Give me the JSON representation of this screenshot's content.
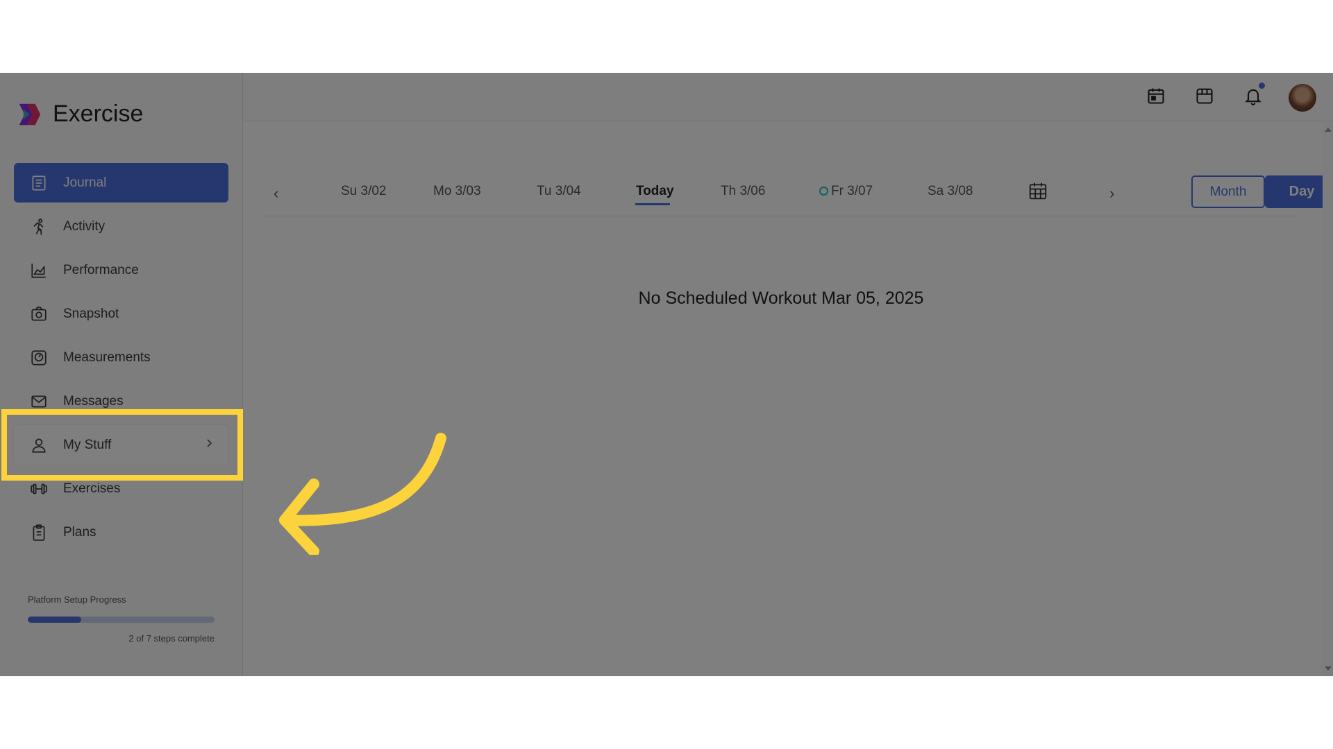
{
  "app": {
    "name": "Exercise"
  },
  "sidebar": {
    "items": [
      {
        "label": "Journal",
        "icon": "journal-icon"
      },
      {
        "label": "Activity",
        "icon": "running-figure-icon"
      },
      {
        "label": "Performance",
        "icon": "area-chart-icon"
      },
      {
        "label": "Snapshot",
        "icon": "camera-icon"
      },
      {
        "label": "Measurements",
        "icon": "scale-icon"
      },
      {
        "label": "Messages",
        "icon": "envelope-icon"
      },
      {
        "label": "My Stuff",
        "icon": "user-icon"
      },
      {
        "label": "Exercises",
        "icon": "dumbbell-icon"
      },
      {
        "label": "Plans",
        "icon": "clipboard-icon"
      }
    ],
    "active": "Journal",
    "highlighted": "My Stuff",
    "progress": {
      "label": "Platform Setup Progress",
      "text": "2 of 7 steps complete",
      "completed": 2,
      "total": 7
    }
  },
  "header": {
    "icons": [
      "calendar-icon",
      "store-icon",
      "bell-icon"
    ],
    "has_notification": true
  },
  "datebar": {
    "days": [
      "Su 3/02",
      "Mo 3/03",
      "Tu 3/04",
      "Today",
      "Th 3/06",
      "Fr 3/07",
      "Sa 3/08"
    ],
    "selected": "Today",
    "month_label": "Month",
    "day_label": "Day"
  },
  "main": {
    "empty_message": "No Scheduled Workout Mar 05, 2025"
  },
  "colors": {
    "accent": "#4a6fdc",
    "highlight": "#fdd33b",
    "dot": "#1fc4c4"
  }
}
